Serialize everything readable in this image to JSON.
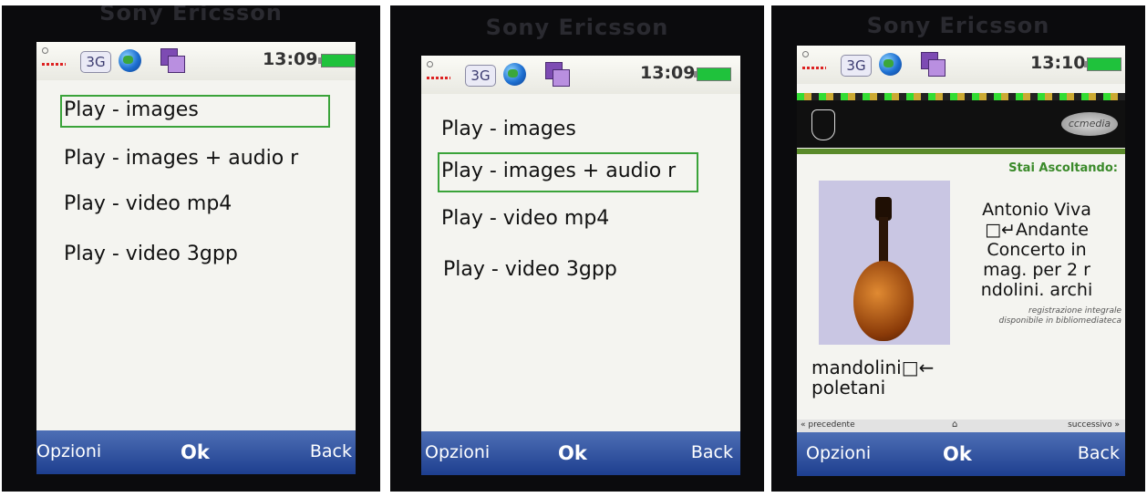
{
  "screens": [
    {
      "brand": "Sony Ericsson",
      "status": {
        "network": "3G",
        "time": "13:09"
      },
      "menu": [
        "Play - images",
        "Play - images + audio r",
        "Play - video mp4",
        "Play - video 3gpp"
      ],
      "selected_index": 0,
      "softkeys": {
        "left": "Opzioni",
        "center": "Ok",
        "right": "Back"
      }
    },
    {
      "brand": "Sony Ericsson",
      "status": {
        "network": "3G",
        "time": "13:09"
      },
      "menu": [
        "Play - images",
        "Play - images + audio r",
        "Play - video mp4",
        "Play - video 3gpp"
      ],
      "selected_index": 1,
      "softkeys": {
        "left": "Opzioni",
        "center": "Ok",
        "right": "Back"
      }
    },
    {
      "brand": "Sony Ericsson",
      "status": {
        "network": "3G",
        "time": "13:10"
      },
      "header": {
        "logo_text": "ccmedia"
      },
      "now_playing_label": "Stai Ascoltando:",
      "song_title_lines": [
        "Antonio Viva",
        "□↵Andante",
        "Concerto in",
        "mag. per 2 r",
        "ndolini. archi"
      ],
      "note_lines": [
        "registrazione integrale",
        "disponibile in bibliomediateca"
      ],
      "extra_lines": [
        "mandolini□←",
        "poletani"
      ],
      "nav": {
        "prev": "« precedente",
        "home_icon": "home-icon",
        "next": "successivo »"
      },
      "softkeys": {
        "left": "Opzioni",
        "center": "Ok",
        "right": "Back"
      }
    }
  ],
  "colors": {
    "selection": "#3aa33a",
    "softbar": "#1e3f8f",
    "accent_green": "#3a8a2a"
  }
}
